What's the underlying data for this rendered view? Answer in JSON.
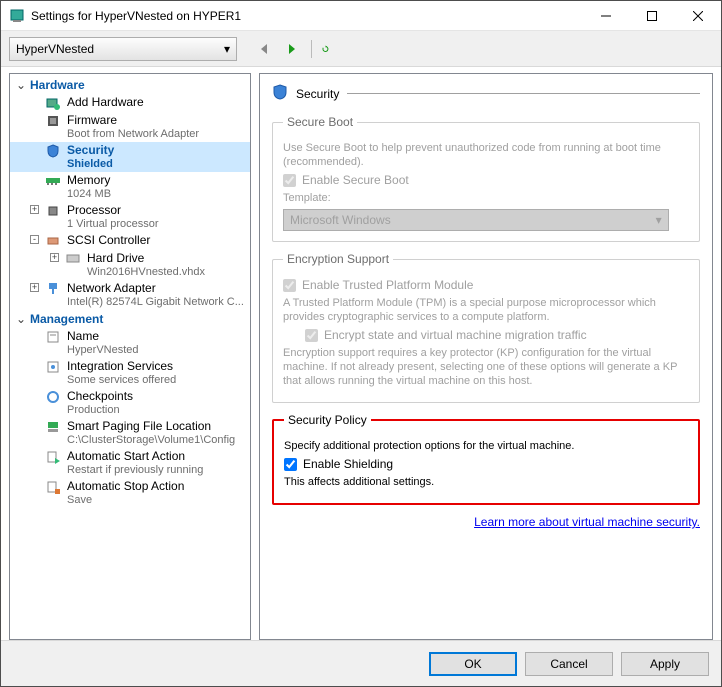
{
  "window": {
    "title": "Settings for HyperVNested on HYPER1"
  },
  "toolbar": {
    "vm_name": "HyperVNested"
  },
  "tree": {
    "cat_hardware": "Hardware",
    "cat_management": "Management",
    "hw": [
      {
        "label": "Add Hardware"
      },
      {
        "label": "Firmware",
        "sub": "Boot from Network Adapter"
      },
      {
        "label": "Security",
        "sub": "Shielded"
      },
      {
        "label": "Memory",
        "sub": "1024 MB"
      },
      {
        "label": "Processor",
        "sub": "1 Virtual processor"
      },
      {
        "label": "SCSI Controller"
      },
      {
        "label": "Hard Drive",
        "sub": "Win2016HVnested.vhdx"
      },
      {
        "label": "Network Adapter",
        "sub": "Intel(R) 82574L Gigabit Network C..."
      }
    ],
    "mg": [
      {
        "label": "Name",
        "sub": "HyperVNested"
      },
      {
        "label": "Integration Services",
        "sub": "Some services offered"
      },
      {
        "label": "Checkpoints",
        "sub": "Production"
      },
      {
        "label": "Smart Paging File Location",
        "sub": "C:\\ClusterStorage\\Volume1\\Config"
      },
      {
        "label": "Automatic Start Action",
        "sub": "Restart if previously running"
      },
      {
        "label": "Automatic Stop Action",
        "sub": "Save"
      }
    ]
  },
  "content": {
    "title": "Security",
    "secure_boot": {
      "legend": "Secure Boot",
      "desc": "Use Secure Boot to help prevent unauthorized code from running at boot time (recommended).",
      "chk": "Enable Secure Boot",
      "template_label": "Template:",
      "template_value": "Microsoft Windows"
    },
    "encryption": {
      "legend": "Encryption Support",
      "chk_tpm": "Enable Trusted Platform Module",
      "tpm_desc": "A Trusted Platform Module (TPM) is a special purpose microprocessor which provides cryptographic services to a compute platform.",
      "chk_encrypt": "Encrypt state and virtual machine migration traffic",
      "desc": "Encryption support requires a key protector (KP) configuration for the virtual machine. If not already present, selecting one of these options will generate a KP that allows running the virtual machine on this host."
    },
    "policy": {
      "legend": "Security Policy",
      "desc": "Specify additional protection options for the virtual machine.",
      "chk": "Enable Shielding",
      "note": "This affects additional settings."
    },
    "link": "Learn more about virtual machine security."
  },
  "footer": {
    "ok": "OK",
    "cancel": "Cancel",
    "apply": "Apply"
  }
}
